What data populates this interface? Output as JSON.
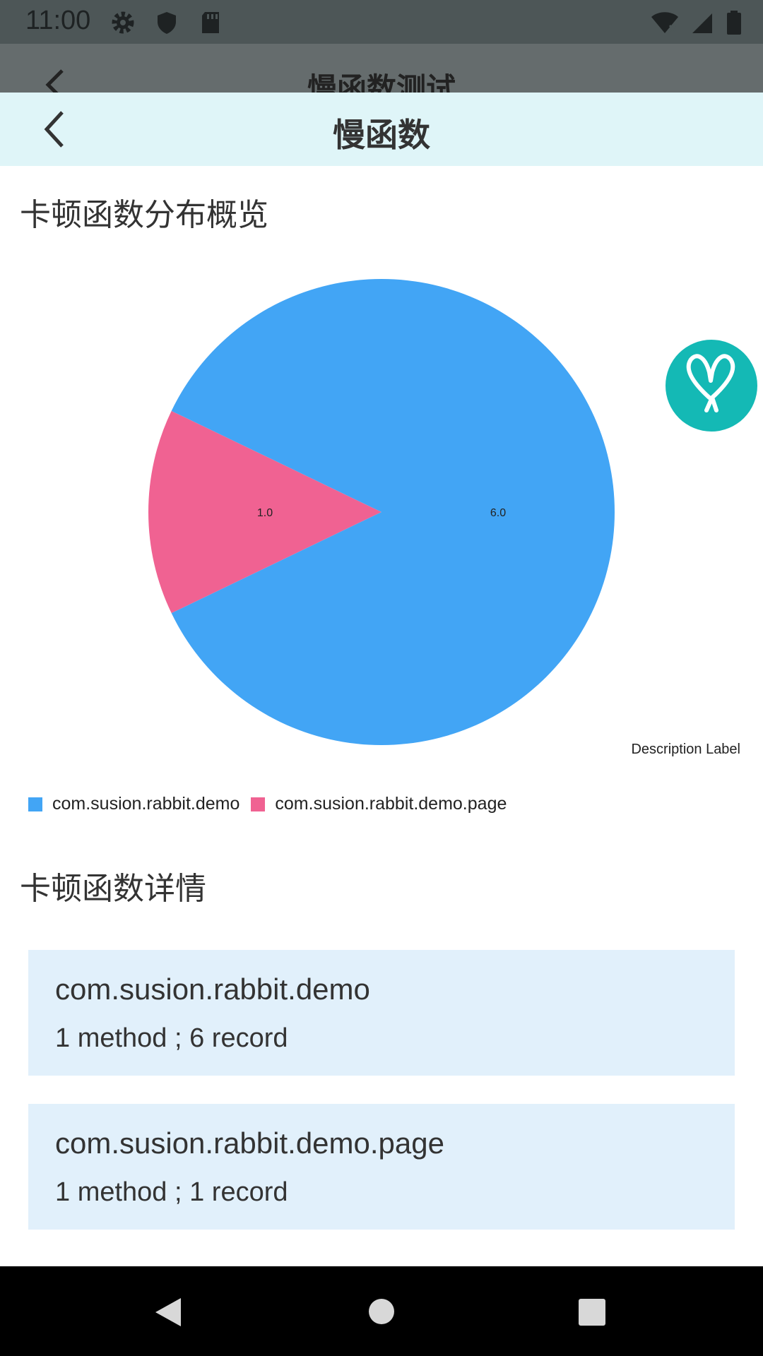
{
  "status_bar": {
    "time": "11:00",
    "left_icons": [
      "gear-icon",
      "shield-icon",
      "sd-card-icon"
    ],
    "right_icons": [
      "wifi-icon",
      "signal-icon",
      "battery-icon"
    ]
  },
  "background_toolbar": {
    "title": "慢函数测试"
  },
  "toolbar": {
    "title": "慢函数"
  },
  "overview": {
    "title": "卡顿函数分布概览"
  },
  "details": {
    "title": "卡顿函数详情"
  },
  "colors": {
    "blue": "#42a5f5",
    "pink": "#f06292",
    "fab": "#14b9b5",
    "appbar": "#dff5f8",
    "card": "#e1f0fb"
  },
  "chart_data": {
    "type": "pie",
    "description": "Description Label",
    "slices": [
      {
        "label": "com.susion.rabbit.demo",
        "value": 6.0,
        "value_label": "6.0",
        "color": "#42a5f5"
      },
      {
        "label": "com.susion.rabbit.demo.page",
        "value": 1.0,
        "value_label": "1.0",
        "color": "#f06292"
      }
    ],
    "legend": [
      "com.susion.rabbit.demo",
      "com.susion.rabbit.demo.page"
    ],
    "legend_position": "bottom-left"
  },
  "cards": [
    {
      "title": "com.susion.rabbit.demo",
      "subtitle": "1 method ; 6 record"
    },
    {
      "title": "com.susion.rabbit.demo.page",
      "subtitle": "1 method ; 1 record"
    }
  ],
  "fab": {
    "icon": "rabbit-logo-icon"
  },
  "nav": {
    "icons": [
      "back-triangle-icon",
      "home-circle-icon",
      "recents-square-icon"
    ]
  }
}
